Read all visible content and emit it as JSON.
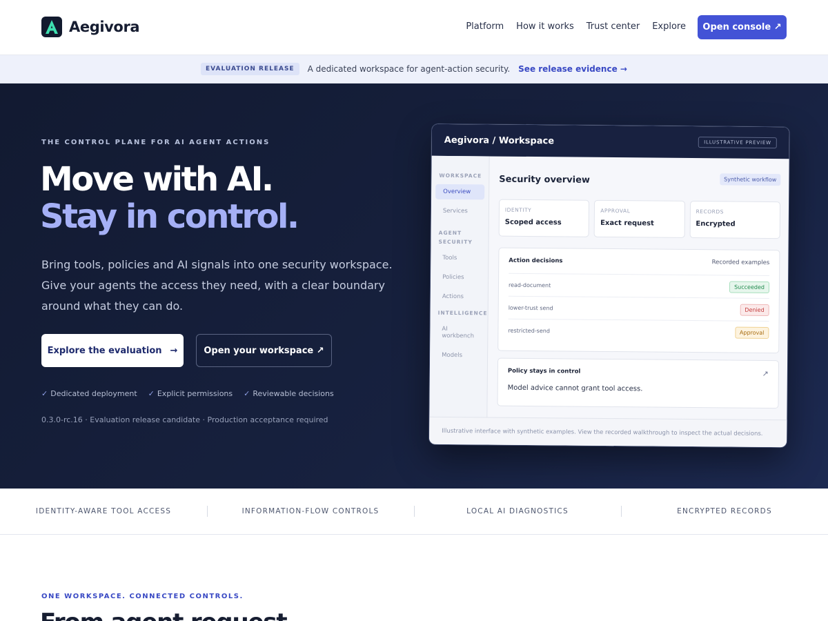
{
  "header": {
    "brand": "Aegivora",
    "nav": [
      "Platform",
      "How it works",
      "Trust center",
      "Explore"
    ],
    "console_button": "Open console ↗"
  },
  "announcement": {
    "badge": "EVALUATION RELEASE",
    "text": "A dedicated workspace for agent-action security.",
    "link": "See release evidence →"
  },
  "hero": {
    "eyebrow": "THE CONTROL PLANE FOR AI AGENT ACTIONS",
    "headline_line1": "Move with AI.",
    "headline_line2": "Stay in control.",
    "lead": "Bring tools, policies and AI signals into one security workspace. Give your agents the access they need, with a clear boundary around what they can do.",
    "primary_button": "Explore the evaluation",
    "primary_arrow": "→",
    "secondary_button": "Open your workspace ↗",
    "checks": [
      "Dedicated deployment",
      "Explicit permissions",
      "Reviewable decisions"
    ],
    "version": "0.3.0-rc.16 · Evaluation release candidate · Production acceptance required"
  },
  "preview": {
    "title": "Aegivora / Workspace",
    "badge": "ILLUSTRATIVE PREVIEW",
    "sidebar": {
      "section_workspace": "WORKSPACE",
      "overview": "Overview",
      "services": "Services",
      "section_agent_security": "AGENT SECURITY",
      "tools": "Tools",
      "policies": "Policies",
      "actions": "Actions",
      "section_intelligence": "INTELLIGENCE",
      "ai_workbench": "AI workbench",
      "models": "Models"
    },
    "heading": "Security overview",
    "synthetic": "Synthetic workflow",
    "cards": [
      {
        "label": "IDENTITY",
        "value": "Scoped access"
      },
      {
        "label": "APPROVAL",
        "value": "Exact request"
      },
      {
        "label": "RECORDS",
        "value": "Encrypted"
      }
    ],
    "decisions_title": "Action decisions",
    "decisions_right": "Recorded examples",
    "decisions": [
      {
        "name": "read-document",
        "status": "Succeeded"
      },
      {
        "name": "lower-trust send",
        "status": "Denied"
      },
      {
        "name": "restricted-send",
        "status": "Approval"
      }
    ],
    "policy_title": "Policy stays in control",
    "policy_text": "Model advice cannot grant tool access.",
    "policy_arrow": "↗",
    "footer": "Illustrative interface with synthetic examples. View the recorded walkthrough to inspect the actual decisions."
  },
  "features": [
    "IDENTITY-AWARE TOOL ACCESS",
    "INFORMATION-FLOW CONTROLS",
    "LOCAL AI DIAGNOSTICS",
    "ENCRYPTED RECORDS"
  ],
  "section": {
    "eyebrow": "ONE WORKSPACE. CONNECTED CONTROLS.",
    "title": "From agent request"
  },
  "colors": {
    "accent": "#4353d6",
    "hero_bg": "#121a31",
    "headline_accent": "#a5b0f6"
  }
}
